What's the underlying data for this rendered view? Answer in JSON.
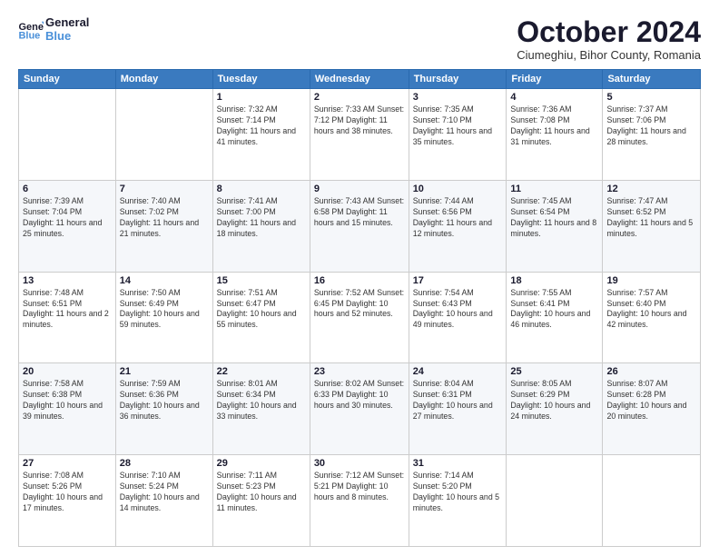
{
  "logo": {
    "line1": "General",
    "line2": "Blue"
  },
  "title": "October 2024",
  "subtitle": "Ciumeghiu, Bihor County, Romania",
  "header_days": [
    "Sunday",
    "Monday",
    "Tuesday",
    "Wednesday",
    "Thursday",
    "Friday",
    "Saturday"
  ],
  "weeks": [
    [
      {
        "day": "",
        "content": ""
      },
      {
        "day": "",
        "content": ""
      },
      {
        "day": "1",
        "content": "Sunrise: 7:32 AM\nSunset: 7:14 PM\nDaylight: 11 hours and 41 minutes."
      },
      {
        "day": "2",
        "content": "Sunrise: 7:33 AM\nSunset: 7:12 PM\nDaylight: 11 hours and 38 minutes."
      },
      {
        "day": "3",
        "content": "Sunrise: 7:35 AM\nSunset: 7:10 PM\nDaylight: 11 hours and 35 minutes."
      },
      {
        "day": "4",
        "content": "Sunrise: 7:36 AM\nSunset: 7:08 PM\nDaylight: 11 hours and 31 minutes."
      },
      {
        "day": "5",
        "content": "Sunrise: 7:37 AM\nSunset: 7:06 PM\nDaylight: 11 hours and 28 minutes."
      }
    ],
    [
      {
        "day": "6",
        "content": "Sunrise: 7:39 AM\nSunset: 7:04 PM\nDaylight: 11 hours and 25 minutes."
      },
      {
        "day": "7",
        "content": "Sunrise: 7:40 AM\nSunset: 7:02 PM\nDaylight: 11 hours and 21 minutes."
      },
      {
        "day": "8",
        "content": "Sunrise: 7:41 AM\nSunset: 7:00 PM\nDaylight: 11 hours and 18 minutes."
      },
      {
        "day": "9",
        "content": "Sunrise: 7:43 AM\nSunset: 6:58 PM\nDaylight: 11 hours and 15 minutes."
      },
      {
        "day": "10",
        "content": "Sunrise: 7:44 AM\nSunset: 6:56 PM\nDaylight: 11 hours and 12 minutes."
      },
      {
        "day": "11",
        "content": "Sunrise: 7:45 AM\nSunset: 6:54 PM\nDaylight: 11 hours and 8 minutes."
      },
      {
        "day": "12",
        "content": "Sunrise: 7:47 AM\nSunset: 6:52 PM\nDaylight: 11 hours and 5 minutes."
      }
    ],
    [
      {
        "day": "13",
        "content": "Sunrise: 7:48 AM\nSunset: 6:51 PM\nDaylight: 11 hours and 2 minutes."
      },
      {
        "day": "14",
        "content": "Sunrise: 7:50 AM\nSunset: 6:49 PM\nDaylight: 10 hours and 59 minutes."
      },
      {
        "day": "15",
        "content": "Sunrise: 7:51 AM\nSunset: 6:47 PM\nDaylight: 10 hours and 55 minutes."
      },
      {
        "day": "16",
        "content": "Sunrise: 7:52 AM\nSunset: 6:45 PM\nDaylight: 10 hours and 52 minutes."
      },
      {
        "day": "17",
        "content": "Sunrise: 7:54 AM\nSunset: 6:43 PM\nDaylight: 10 hours and 49 minutes."
      },
      {
        "day": "18",
        "content": "Sunrise: 7:55 AM\nSunset: 6:41 PM\nDaylight: 10 hours and 46 minutes."
      },
      {
        "day": "19",
        "content": "Sunrise: 7:57 AM\nSunset: 6:40 PM\nDaylight: 10 hours and 42 minutes."
      }
    ],
    [
      {
        "day": "20",
        "content": "Sunrise: 7:58 AM\nSunset: 6:38 PM\nDaylight: 10 hours and 39 minutes."
      },
      {
        "day": "21",
        "content": "Sunrise: 7:59 AM\nSunset: 6:36 PM\nDaylight: 10 hours and 36 minutes."
      },
      {
        "day": "22",
        "content": "Sunrise: 8:01 AM\nSunset: 6:34 PM\nDaylight: 10 hours and 33 minutes."
      },
      {
        "day": "23",
        "content": "Sunrise: 8:02 AM\nSunset: 6:33 PM\nDaylight: 10 hours and 30 minutes."
      },
      {
        "day": "24",
        "content": "Sunrise: 8:04 AM\nSunset: 6:31 PM\nDaylight: 10 hours and 27 minutes."
      },
      {
        "day": "25",
        "content": "Sunrise: 8:05 AM\nSunset: 6:29 PM\nDaylight: 10 hours and 24 minutes."
      },
      {
        "day": "26",
        "content": "Sunrise: 8:07 AM\nSunset: 6:28 PM\nDaylight: 10 hours and 20 minutes."
      }
    ],
    [
      {
        "day": "27",
        "content": "Sunrise: 7:08 AM\nSunset: 5:26 PM\nDaylight: 10 hours and 17 minutes."
      },
      {
        "day": "28",
        "content": "Sunrise: 7:10 AM\nSunset: 5:24 PM\nDaylight: 10 hours and 14 minutes."
      },
      {
        "day": "29",
        "content": "Sunrise: 7:11 AM\nSunset: 5:23 PM\nDaylight: 10 hours and 11 minutes."
      },
      {
        "day": "30",
        "content": "Sunrise: 7:12 AM\nSunset: 5:21 PM\nDaylight: 10 hours and 8 minutes."
      },
      {
        "day": "31",
        "content": "Sunrise: 7:14 AM\nSunset: 5:20 PM\nDaylight: 10 hours and 5 minutes."
      },
      {
        "day": "",
        "content": ""
      },
      {
        "day": "",
        "content": ""
      }
    ]
  ]
}
